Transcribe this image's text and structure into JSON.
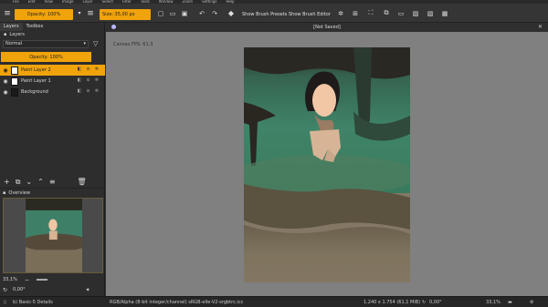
{
  "menu": [
    "File",
    "Edit",
    "View",
    "Image",
    "Layer",
    "Select",
    "Filter",
    "Tools",
    "Window",
    "Zoom",
    "Settings",
    "Help"
  ],
  "toolbar": {
    "opacity_label": "Opacity: 100%",
    "size_label": "Size: 35,00 px",
    "show_brush_presets": "Show Brush Presets",
    "show_brush_editor": "Show Brush Editor"
  },
  "docker": {
    "tabs": [
      "Layers",
      "Toolbox"
    ],
    "layers_title": "Layers",
    "blend_mode": "Normal",
    "opacity_label": "Opacity:  100%",
    "layers": [
      {
        "name": "Paint Layer 2",
        "selected": true
      },
      {
        "name": "Paint Layer 1",
        "selected": false
      },
      {
        "name": "Background",
        "selected": false
      }
    ],
    "overview_title": "Overview",
    "zoom_value": "33,1%",
    "rotation_value": "0,00°"
  },
  "canvas": {
    "doc_title": "[Not Saved]",
    "fps": "Canvas FPS: 61,3"
  },
  "status": {
    "brush": "b) Basic-5 Details",
    "color_profile": "RGB/Alpha (8-bit integer/channel)  sRGB-elle-V2-srgbtrc.icc",
    "dimensions": "1.240 x 1.754 (61,1 MiB)",
    "rotation": "0,00°",
    "zoom": "33,1%"
  },
  "colors": {
    "accent": "#f0a30a",
    "canvas_bg": "#808080",
    "panel": "#2d2d2d"
  }
}
